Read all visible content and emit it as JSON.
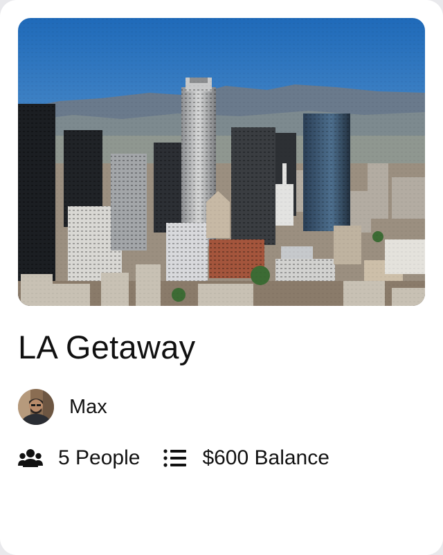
{
  "trip": {
    "title": "LA Getaway",
    "image_alt": "Downtown Los Angeles skyline",
    "owner": {
      "name": "Max"
    },
    "people_label": "5 People",
    "balance_label": "$600 Balance"
  },
  "icons": {
    "people": "people-group-icon",
    "balance": "list-icon"
  },
  "colors": {
    "card": "#ffffff",
    "text": "#111111",
    "sky": "#2f78c4"
  }
}
